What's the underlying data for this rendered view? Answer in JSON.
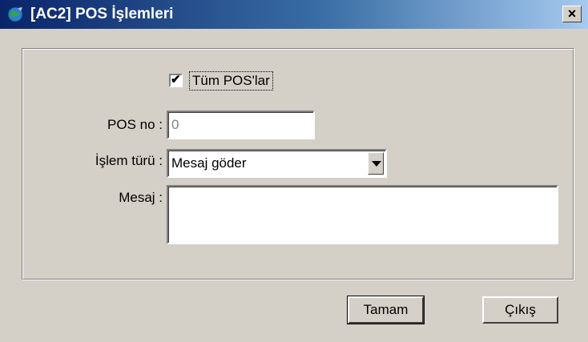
{
  "window": {
    "title": "[AC2] POS İşlemleri",
    "close_symbol": "×",
    "app_icon": "globe-icon"
  },
  "form": {
    "all_pos_label": "Tüm POS'lar",
    "all_pos_checked": true,
    "check_symbol": "✔",
    "pos_no_label": "POS no :",
    "pos_no_value": "0",
    "operation_type_label": "İşlem türü :",
    "operation_type_value": "Mesaj göder",
    "message_label": "Mesaj :",
    "message_value": ""
  },
  "buttons": {
    "ok_label": "Tamam",
    "exit_label": "Çıkış"
  },
  "colors": {
    "title_start": "#0a246a",
    "title_end": "#a6caf0",
    "face": "#d4d0c8"
  }
}
